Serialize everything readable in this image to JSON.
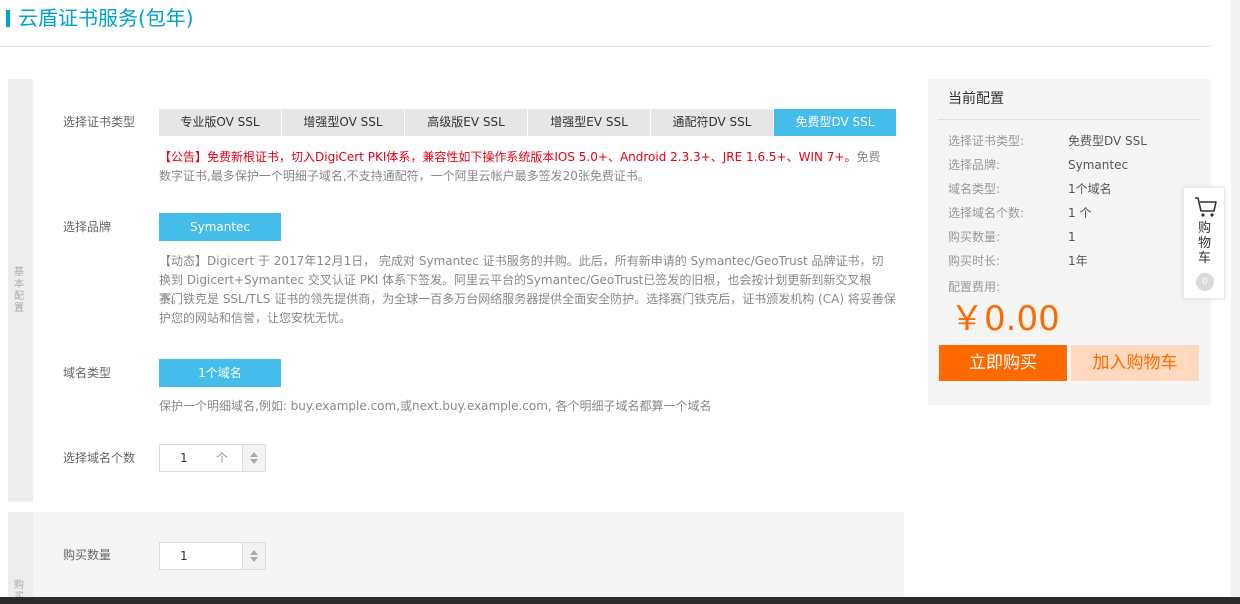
{
  "header": {
    "title": "云盾证书服务(包年)"
  },
  "basic_section": {
    "side_label": "基本配置",
    "cert_type": {
      "label": "选择证书类型",
      "options": [
        "专业版OV SSL",
        "增强型OV SSL",
        "高级版EV SSL",
        "增强型EV SSL",
        "通配符DV SSL",
        "免费型DV SSL"
      ],
      "selected": "免费型DV SSL",
      "notice_red": "【公告】免费新根证书，切入DigiCert PKI体系，兼容性如下操作系统版本IOS 5.0+、Android 2.3.3+、JRE 1.6.5+、WIN 7+。",
      "notice_gray": "免费数字证书,最多保护一个明细子域名,不支持通配符，一个阿里云帐户最多签发20张免费证书。"
    },
    "brand": {
      "label": "选择品牌",
      "value": "Symantec",
      "desc_line1": "【动态】Digicert 于 2017年12月1日， 完成对 Symantec 证书服务的并购。此后，所有新申请的 Symantec/GeoTrust 品牌证书，切换到 Digicert+Symantec 交叉认证 PKI 体系下签发。阿里云平台的Symantec/GeoTrust已签发的旧根，也会按计划更新到新交叉根下。",
      "desc_line2": "赛门铁克是 SSL/TLS 证书的领先提供商，为全球一百多万台网络服务器提供全面安全防护。选择赛门铁克后，证书颁发机构 (CA) 将妥善保护您的网站和信誉，让您安枕无忧。"
    },
    "domain_type": {
      "label": "域名类型",
      "value": "1个域名",
      "desc": "保护一个明细域名,例如: buy.example.com,或next.buy.example.com, 各个明细子域名都算一个域名"
    },
    "domain_count": {
      "label": "选择域名个数",
      "value": "1",
      "unit": "个"
    }
  },
  "buy_section": {
    "side_label": "购买量",
    "quantity": {
      "label": "购买数量",
      "value": "1"
    }
  },
  "summary": {
    "title": "当前配置",
    "rows": [
      {
        "key": "选择证书类型:",
        "value": "免费型DV SSL"
      },
      {
        "key": "选择品牌:",
        "value": "Symantec"
      },
      {
        "key": "域名类型:",
        "value": "1个域名"
      },
      {
        "key": "选择域名个数:",
        "value": "1 个"
      },
      {
        "key": "购买数量:",
        "value": "1"
      },
      {
        "key": "购买时长:",
        "value": "1年"
      }
    ],
    "fee_label": "配置费用:",
    "price": "￥0.00",
    "buy_button": "立即购买",
    "cart_button": "加入购物车"
  },
  "cart_float": {
    "label": "购物车",
    "count": "0",
    "icon": "cart-icon"
  },
  "colors": {
    "accent": "#00a2ca",
    "tab_active": "#44bdeb",
    "orange": "#ff6a00",
    "orange_light": "#ffd9bd",
    "notice_red": "#e60012"
  }
}
